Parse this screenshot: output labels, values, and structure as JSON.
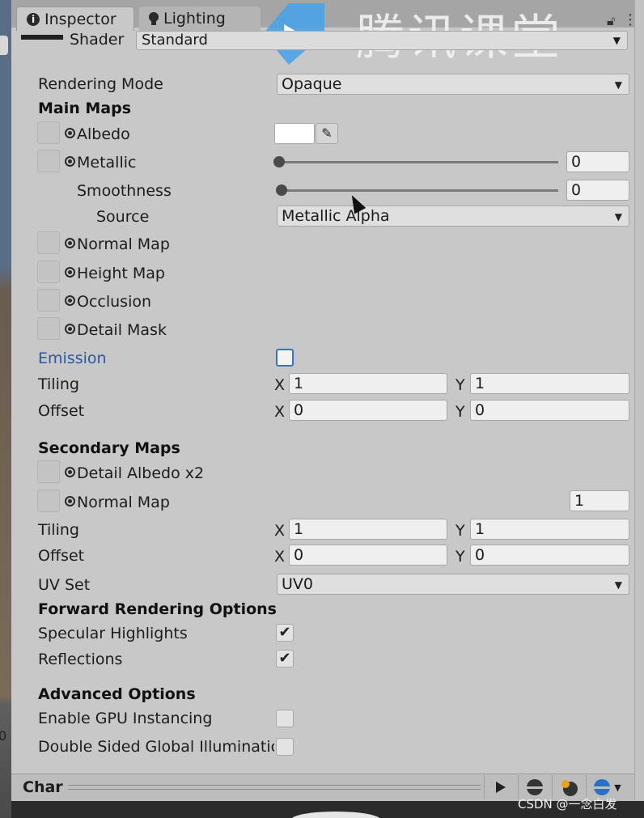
{
  "tabs": {
    "inspector": "Inspector",
    "lighting": "Lighting"
  },
  "watermark": "腾讯课堂",
  "shader": {
    "label": "Shader",
    "value": "Standard"
  },
  "rendering_mode": {
    "label": "Rendering Mode",
    "value": "Opaque"
  },
  "main_maps": {
    "header": "Main Maps",
    "albedo": "Albedo",
    "albedo_color": "#ffffff",
    "metallic": {
      "label": "Metallic",
      "value": "0",
      "slider": 0
    },
    "smoothness": {
      "label": "Smoothness",
      "value": "0",
      "slider": 0
    },
    "source": {
      "label": "Source",
      "value": "Metallic Alpha"
    },
    "normal_map": "Normal Map",
    "height_map": "Height Map",
    "occlusion": "Occlusion",
    "detail_mask": "Detail Mask",
    "emission": "Emission",
    "tiling": {
      "label": "Tiling",
      "x": "1",
      "y": "1"
    },
    "offset": {
      "label": "Offset",
      "x": "0",
      "y": "0"
    }
  },
  "axis": {
    "x": "X",
    "y": "Y"
  },
  "secondary_maps": {
    "header": "Secondary Maps",
    "detail_albedo": "Detail Albedo x2",
    "normal_map": "Normal Map",
    "normal_scale": "1",
    "tiling": {
      "label": "Tiling",
      "x": "1",
      "y": "1"
    },
    "offset": {
      "label": "Offset",
      "x": "0",
      "y": "0"
    },
    "uv_set": {
      "label": "UV Set",
      "value": "UV0"
    }
  },
  "forward_rendering": {
    "header": "Forward Rendering Options",
    "specular": "Specular Highlights",
    "specular_checked": true,
    "reflections": "Reflections",
    "reflections_checked": true
  },
  "advanced": {
    "header": "Advanced Options",
    "gpu_instancing": "Enable GPU Instancing",
    "gpu_instancing_checked": false,
    "double_sided_gi": "Double Sided Global Illuminatic",
    "double_sided_gi_checked": false
  },
  "bottom_bar": {
    "label": "Char"
  },
  "scene_strip_value": "0",
  "footer_watermark": "CSDN @一念白发",
  "check_mark": "✔",
  "dropdown_arrow": "▼",
  "colors": {
    "emission_accent": "#3a72c8",
    "logo_blue": "#4aa3e8"
  }
}
